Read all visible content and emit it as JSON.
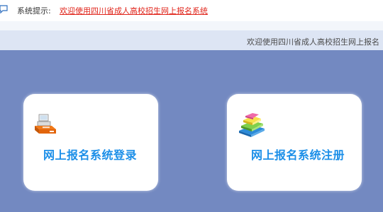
{
  "notice": {
    "label": "系统提示:",
    "link_text": "欢迎使用四川省成人高校招生网上报名系统"
  },
  "marquee": {
    "text": "欢迎使用四川省成人高校招生网上报名"
  },
  "cards": {
    "login_label": "网上报名系统登录",
    "register_label": "网上报名系统注册"
  },
  "colors": {
    "background": "#7389c1",
    "notice_link": "#e0241a",
    "card_label": "#1c8fe8"
  },
  "icons": {
    "notice": "speech-bubble-icon",
    "login": "computer-icon",
    "register": "books-icon"
  }
}
